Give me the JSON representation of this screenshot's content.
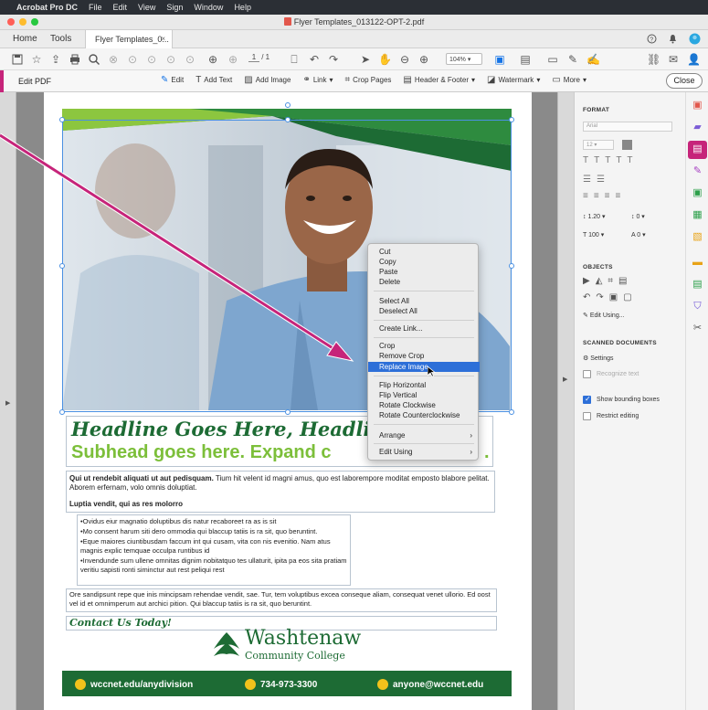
{
  "menubar": {
    "app": "Acrobat Pro DC",
    "items": [
      "File",
      "Edit",
      "View",
      "Sign",
      "Window",
      "Help"
    ]
  },
  "window": {
    "title": "Flyer Templates_013122-OPT-2.pdf"
  },
  "tabs": {
    "home": "Home",
    "tools": "Tools",
    "doc": "Flyer Templates_0...",
    "doc_close": "×"
  },
  "toolbar": {
    "page_current": "1",
    "page_total": "/ 1",
    "zoom": "104%"
  },
  "editbar": {
    "label": "Edit PDF",
    "tools": [
      {
        "label": "Edit",
        "icon": "edit-icon"
      },
      {
        "label": "Add Text",
        "icon": "add-text-icon"
      },
      {
        "label": "Add Image",
        "icon": "add-image-icon"
      },
      {
        "label": "Link",
        "icon": "link-icon"
      },
      {
        "label": "Crop Pages",
        "icon": "crop-icon"
      },
      {
        "label": "Header & Footer",
        "icon": "header-footer-icon"
      },
      {
        "label": "Watermark",
        "icon": "watermark-icon"
      },
      {
        "label": "More",
        "icon": "more-icon"
      }
    ],
    "close": "Close"
  },
  "flyer": {
    "headline": "Headline Goes Here, Headlin",
    "subhead": "Subhead goes here. Expand c",
    "subhead_tail": ".",
    "para1_bold": "Qui ut rendebit aliquati ut aut pedisquam.",
    "para1": " Tium hit velent id magni amus, quo est laborempore moditat emposto blabore pelitat. Aborem erfernam, volo omnis doluptiat.",
    "section_title": "Luptia vendit, qui as res molorro",
    "bullets": [
      "•Ovidus eiur magnatio doluptibus dis natur recaboreet ra as is sit",
      "•Mo consent harum siti dero ommodia qui blaccup tatiis is ra sit, quo beruntint.",
      "•Eque maiores ciuntibusdam faccum int qui cusam, vita con nis evenitio. Nam atus magnis explic temquae occulpa runtibus id",
      "•Invendunde sum ullene omnitas dignim nobitatquo tes ullaturit, ipita pa eos sita pratiam veritiu sapisti ronti siminctur aut rest peliqui rest"
    ],
    "para2": "Ore sandipsunt repe que inis mincipsam rehendae vendit, sae. Tur, tem voluptibus excea conseque aliam, consequat venet ullorio. Ed oost vel id et omnimperum aut archici pition. Qui blaccup tatiis is ra sit, quo beruntint.",
    "contact": "Contact Us Today!",
    "logo_name": "Washtenaw",
    "logo_sub": "Community College",
    "footer": {
      "web": "wccnet.edu/anydivision",
      "phone": "734-973-3300",
      "email": "anyone@wccnet.edu"
    }
  },
  "context_menu": {
    "items": [
      {
        "label": "Cut"
      },
      {
        "label": "Copy"
      },
      {
        "label": "Paste"
      },
      {
        "label": "Delete"
      },
      {
        "label": "Select All"
      },
      {
        "label": "Deselect All"
      },
      {
        "label": "Create Link..."
      },
      {
        "label": "Crop"
      },
      {
        "label": "Remove Crop"
      },
      {
        "label": "Replace Image",
        "selected": true
      },
      {
        "label": "Flip Horizontal"
      },
      {
        "label": "Flip Vertical"
      },
      {
        "label": "Rotate Clockwise"
      },
      {
        "label": "Rotate Counterclockwise"
      },
      {
        "label": "Arrange",
        "submenu": true
      },
      {
        "label": "Edit Using",
        "submenu": true
      }
    ]
  },
  "right_panel": {
    "format_heading": "FORMAT",
    "font_placeholder": "Arial",
    "font_size": "12",
    "line_spacing": "1.20",
    "para_spacing": "0",
    "scale": "100",
    "char_spacing": "0",
    "objects_heading": "OBJECTS",
    "edit_using": "Edit Using...",
    "scanned_heading": "SCANNED DOCUMENTS",
    "settings": "Settings",
    "recognize_text": "Recognize text",
    "show_bounding_boxes": "Show bounding boxes",
    "show_bounding_boxes_checked": true,
    "restrict_editing": "Restrict editing",
    "restrict_editing_checked": false
  },
  "colors": {
    "accent": "#c6247a",
    "green_dark": "#1d6b34",
    "green_light": "#7cbf3a",
    "menu_highlight": "#2d6fd8"
  }
}
